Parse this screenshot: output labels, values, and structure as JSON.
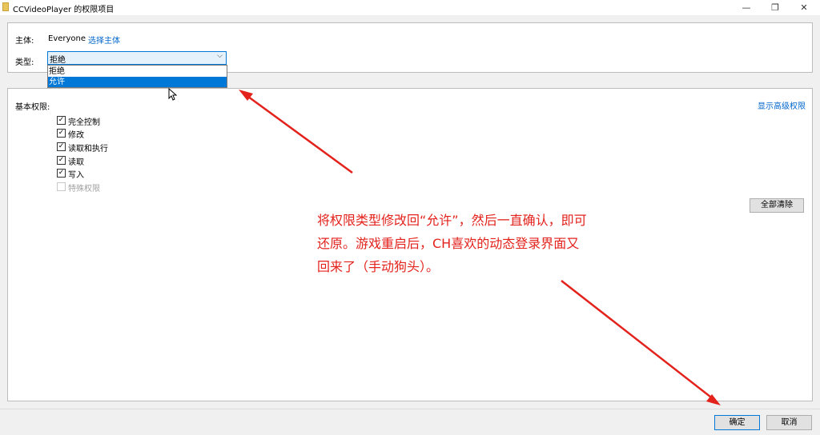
{
  "window": {
    "title": "CCVideoPlayer 的权限项目",
    "minimize_glyph": "—",
    "maximize_glyph": "❐",
    "close_glyph": "✕"
  },
  "principal": {
    "label": "主体:",
    "value": "Everyone",
    "select_link": "选择主体"
  },
  "type": {
    "label": "类型:",
    "selected": "拒绝",
    "options": [
      "拒绝",
      "允许"
    ],
    "highlighted": "允许"
  },
  "permissions": {
    "section_label": "基本权限:",
    "advanced_link": "显示高级权限",
    "items": [
      {
        "label": "完全控制",
        "checked": true,
        "enabled": true
      },
      {
        "label": "修改",
        "checked": true,
        "enabled": true
      },
      {
        "label": "读取和执行",
        "checked": true,
        "enabled": true
      },
      {
        "label": "读取",
        "checked": true,
        "enabled": true
      },
      {
        "label": "写入",
        "checked": true,
        "enabled": true
      },
      {
        "label": "特殊权限",
        "checked": false,
        "enabled": false
      }
    ],
    "clear_all_label": "全部清除"
  },
  "footer": {
    "ok_label": "确定",
    "cancel_label": "取消"
  },
  "annotation": {
    "lines": [
      "将权限类型修改回“允许”，然后一直确认，即可",
      "还原。游戏重启后，CH喜欢的动态登录界面又",
      "回来了（手动狗头）。"
    ],
    "color": "#e3221c"
  },
  "check_glyph": "✓",
  "chevron_glyph": "⌵"
}
